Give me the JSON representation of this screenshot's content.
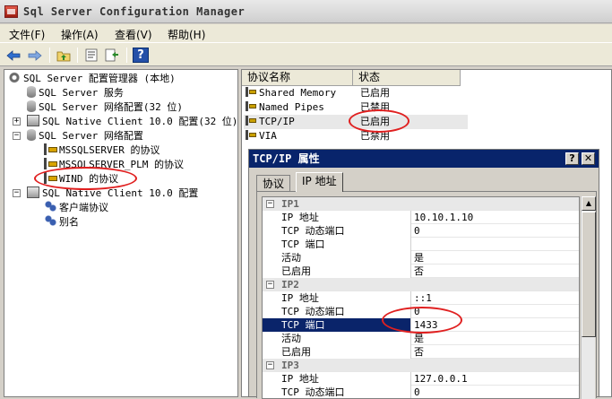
{
  "window": {
    "title": "Sql Server Configuration Manager"
  },
  "menu": [
    "文件(F)",
    "操作(A)",
    "查看(V)",
    "帮助(H)"
  ],
  "toolbar": {
    "back": "back-arrow-icon",
    "forward": "forward-arrow-icon",
    "up": "up-folder-icon",
    "properties": "properties-icon",
    "export": "export-list-icon",
    "help": "?"
  },
  "tree": [
    {
      "label": "SQL Server 配置管理器 (本地)",
      "icon": "server-config-icon"
    },
    {
      "label": "SQL Server 服务",
      "icon": "services-icon"
    },
    {
      "label": "SQL Server 网络配置(32 位)",
      "icon": "network-config-icon"
    },
    {
      "label": "SQL Native Client 10.0 配置(32 位)",
      "icon": "client-config-icon"
    },
    {
      "label": "SQL Server 网络配置",
      "icon": "network-config-icon"
    },
    {
      "label": "MSSQLSERVER 的协议",
      "icon": "protocol-icon"
    },
    {
      "label": "MSSQLSERVER_PLM 的协议",
      "icon": "protocol-icon"
    },
    {
      "label": "WIND 的协议",
      "icon": "protocol-icon"
    },
    {
      "label": "SQL Native Client 10.0 配置",
      "icon": "client-config-icon"
    },
    {
      "label": "客户端协议",
      "icon": "client-protocol-icon"
    },
    {
      "label": "别名",
      "icon": "alias-icon"
    }
  ],
  "list": {
    "headers": [
      "协议名称",
      "状态"
    ],
    "rows": [
      {
        "name": "Shared Memory",
        "status": "已启用"
      },
      {
        "name": "Named Pipes",
        "status": "已禁用"
      },
      {
        "name": "TCP/IP",
        "status": "已启用"
      },
      {
        "name": "VIA",
        "status": "已禁用"
      }
    ]
  },
  "dialog": {
    "title": "TCP/IP 属性",
    "help_btn": "?",
    "close_btn": "✕",
    "tabs": [
      "协议",
      "IP 地址"
    ],
    "grid": [
      {
        "type": "section",
        "label": "IP1"
      },
      {
        "name": "IP 地址",
        "value": "10.10.1.10"
      },
      {
        "name": "TCP 动态端口",
        "value": "0"
      },
      {
        "name": "TCP 端口",
        "value": ""
      },
      {
        "name": "活动",
        "value": "是"
      },
      {
        "name": "已启用",
        "value": "否"
      },
      {
        "type": "section",
        "label": "IP2"
      },
      {
        "name": "IP 地址",
        "value": "::1"
      },
      {
        "name": "TCP 动态端口",
        "value": "0"
      },
      {
        "name": "TCP 端口",
        "value": "1433",
        "selected": true
      },
      {
        "name": "活动",
        "value": "是"
      },
      {
        "name": "已启用",
        "value": "否"
      },
      {
        "type": "section",
        "label": "IP3"
      },
      {
        "name": "IP 地址",
        "value": "127.0.0.1"
      },
      {
        "name": "TCP 动态端口",
        "value": "0"
      }
    ]
  },
  "colors": {
    "dialog_title_bg": "#08246b",
    "selection_bg": "#0a246a",
    "annotation_red": "#e02020"
  }
}
